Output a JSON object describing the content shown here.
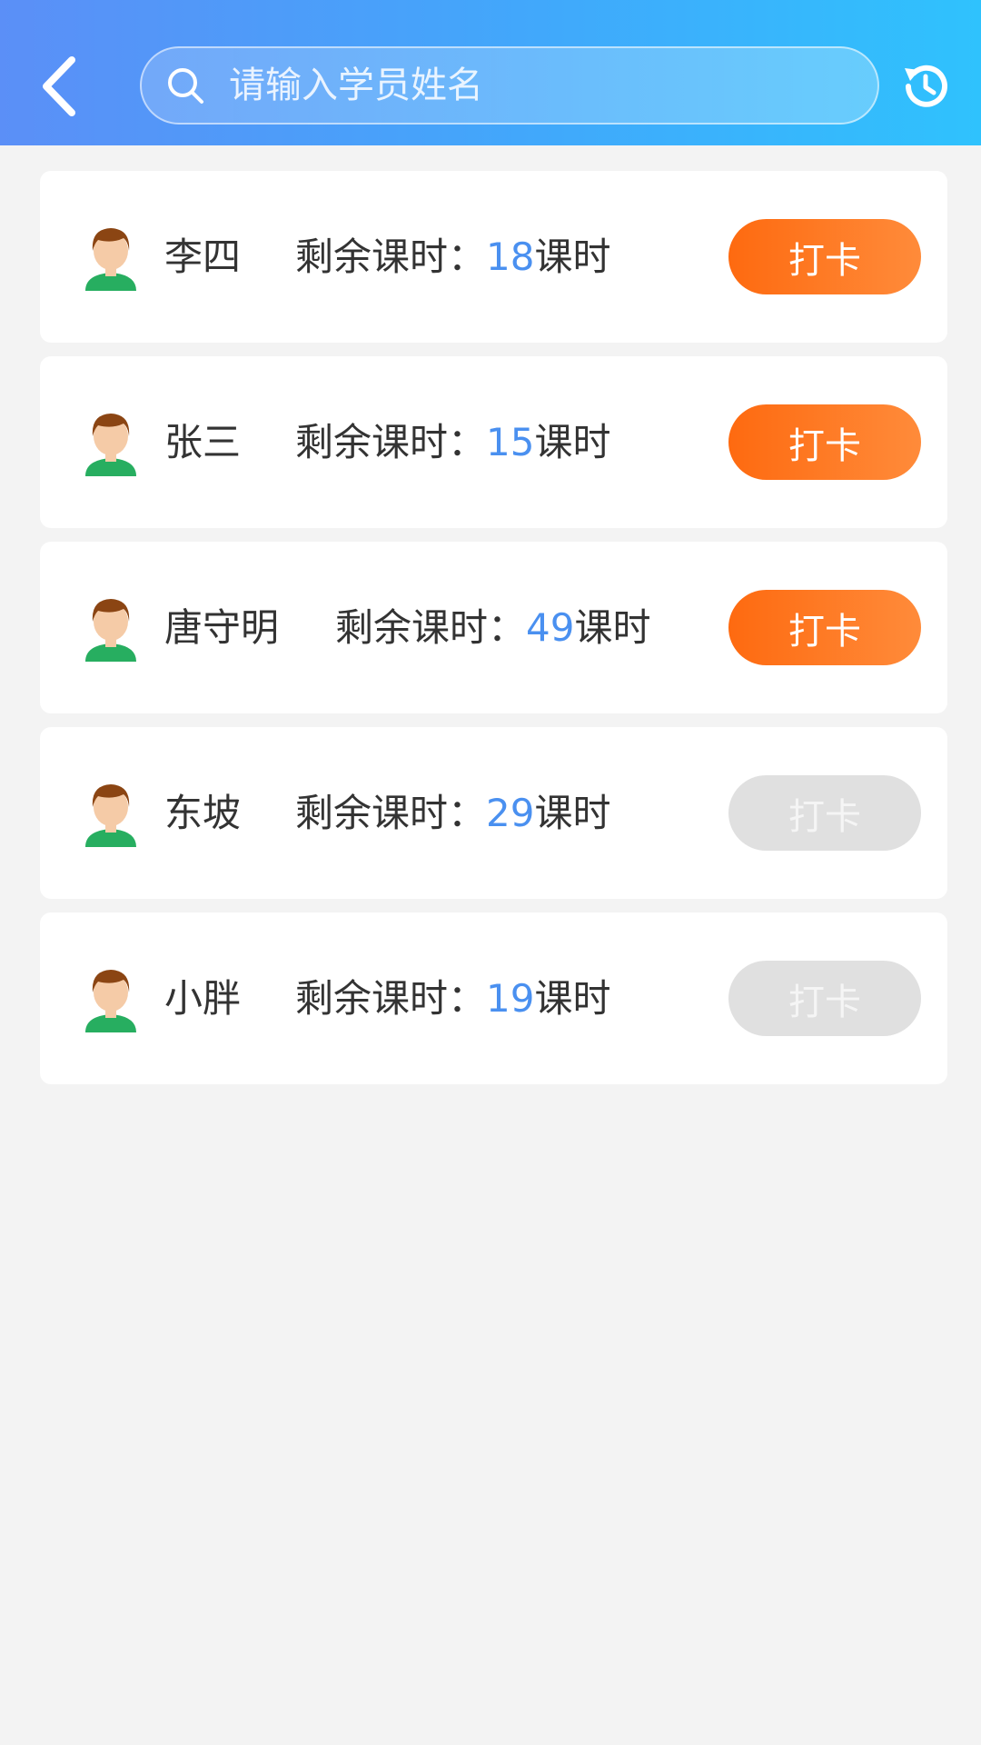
{
  "header": {
    "back_icon": "chevron-left-icon",
    "search_icon": "search-icon",
    "search_placeholder": "请输入学员姓名",
    "search_value": "",
    "history_icon": "history-icon"
  },
  "colors": {
    "accent_orange": "#fe6a10",
    "number_blue": "#4a90f0",
    "disabled_gray": "#e0e0e0",
    "header_gradient_start": "#5b8ff7",
    "header_gradient_end": "#2fc2fd"
  },
  "students": [
    {
      "name": "李四",
      "hours_label": "剩余课时：",
      "hours_value": "18",
      "hours_unit": "课时",
      "button_label": "打卡",
      "enabled": true
    },
    {
      "name": "张三",
      "hours_label": "剩余课时：",
      "hours_value": "15",
      "hours_unit": "课时",
      "button_label": "打卡",
      "enabled": true
    },
    {
      "name": "唐守明",
      "hours_label": "剩余课时：",
      "hours_value": "49",
      "hours_unit": "课时",
      "button_label": "打卡",
      "enabled": true
    },
    {
      "name": "东坡",
      "hours_label": "剩余课时：",
      "hours_value": "29",
      "hours_unit": "课时",
      "button_label": "打卡",
      "enabled": false
    },
    {
      "name": "小胖",
      "hours_label": "剩余课时：",
      "hours_value": "19",
      "hours_unit": "课时",
      "button_label": "打卡",
      "enabled": false
    }
  ]
}
